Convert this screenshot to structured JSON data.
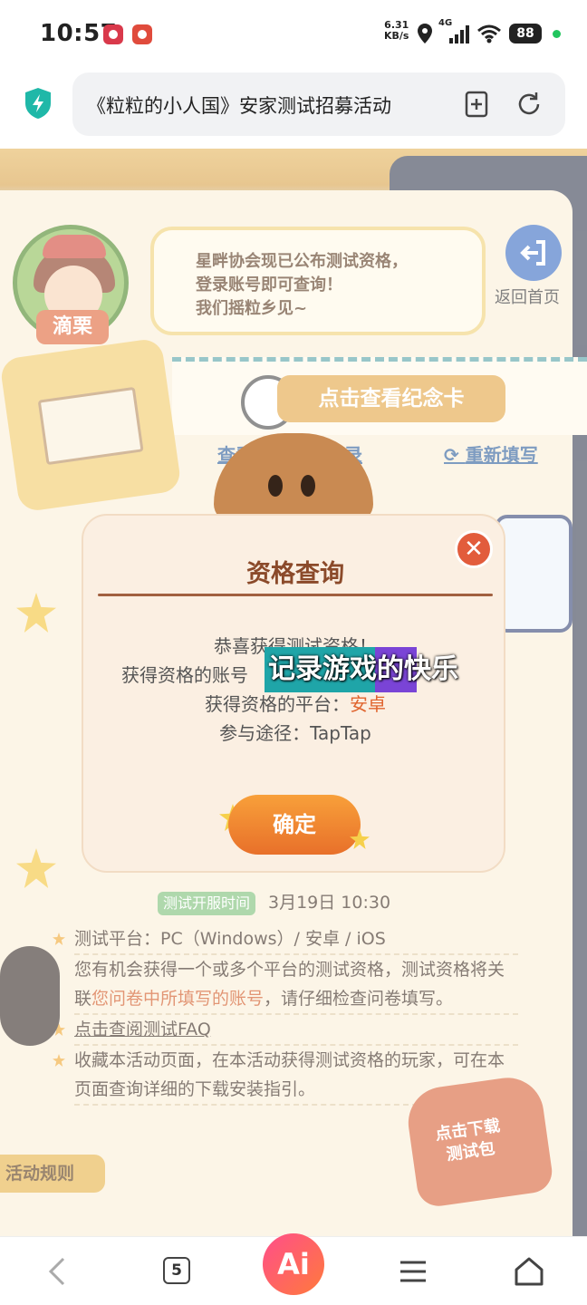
{
  "status_bar": {
    "time": "10:57",
    "net_speed_value": "6.31",
    "net_speed_unit": "KB/s",
    "network_type": "4G",
    "battery": "88",
    "indicator_color": "#22c55e"
  },
  "address_bar": {
    "url_title": "《粒粒的小人国》安家测试招募活动",
    "icons": [
      "security-shield-icon",
      "add-tab-icon",
      "reload-icon"
    ]
  },
  "page": {
    "character_name": "滴栗",
    "bubble_text": "星畔协会现已公布测试资格，\n登录账号即可查询！\n我们摇粒乡见~",
    "home_label": "返回首页",
    "souvenir_button": "点击查看纪念卡",
    "view_record_link": "查看问卷填写记录",
    "refill_link": "重新填写",
    "test_time_tag": "测试开服时间",
    "test_time_value": "3月19日 10:30",
    "rule_platform": "测试平台：PC（Windows）/ 安卓 / iOS",
    "rule_account_1": "您有机会获得一个或多个平台的测试资格，测试资格将关联",
    "rule_account_hl": "您问卷中所填写的账号",
    "rule_account_2": "，请仔细检查问卷填写。",
    "faq_link": "点击查阅测试FAQ",
    "rule_collect": "收藏本活动页面，在本活动获得测试资格的玩家，可在本页面查询详细的下载安装指引。",
    "activity_rules_tab": "活动规则",
    "download_badge": "点击下载\n测试包"
  },
  "modal": {
    "title": "资格查询",
    "congrats": "恭喜获得测试资格！",
    "account_label": "获得资格的账号",
    "platform_label": "获得资格的平台：",
    "platform_value": "安卓",
    "channel": "参与途径：TapTap",
    "confirm_button": "确定",
    "close_icon": "close-icon"
  },
  "subtitle": "记录游戏的快乐",
  "bottom_nav": {
    "tab_count": "5",
    "ai_label": "Ai"
  },
  "colors": {
    "accent_orange": "#e8702a",
    "title_brown": "#8b4a2a",
    "highlight": "#e0642e",
    "link_blue": "#2f5f9c"
  }
}
